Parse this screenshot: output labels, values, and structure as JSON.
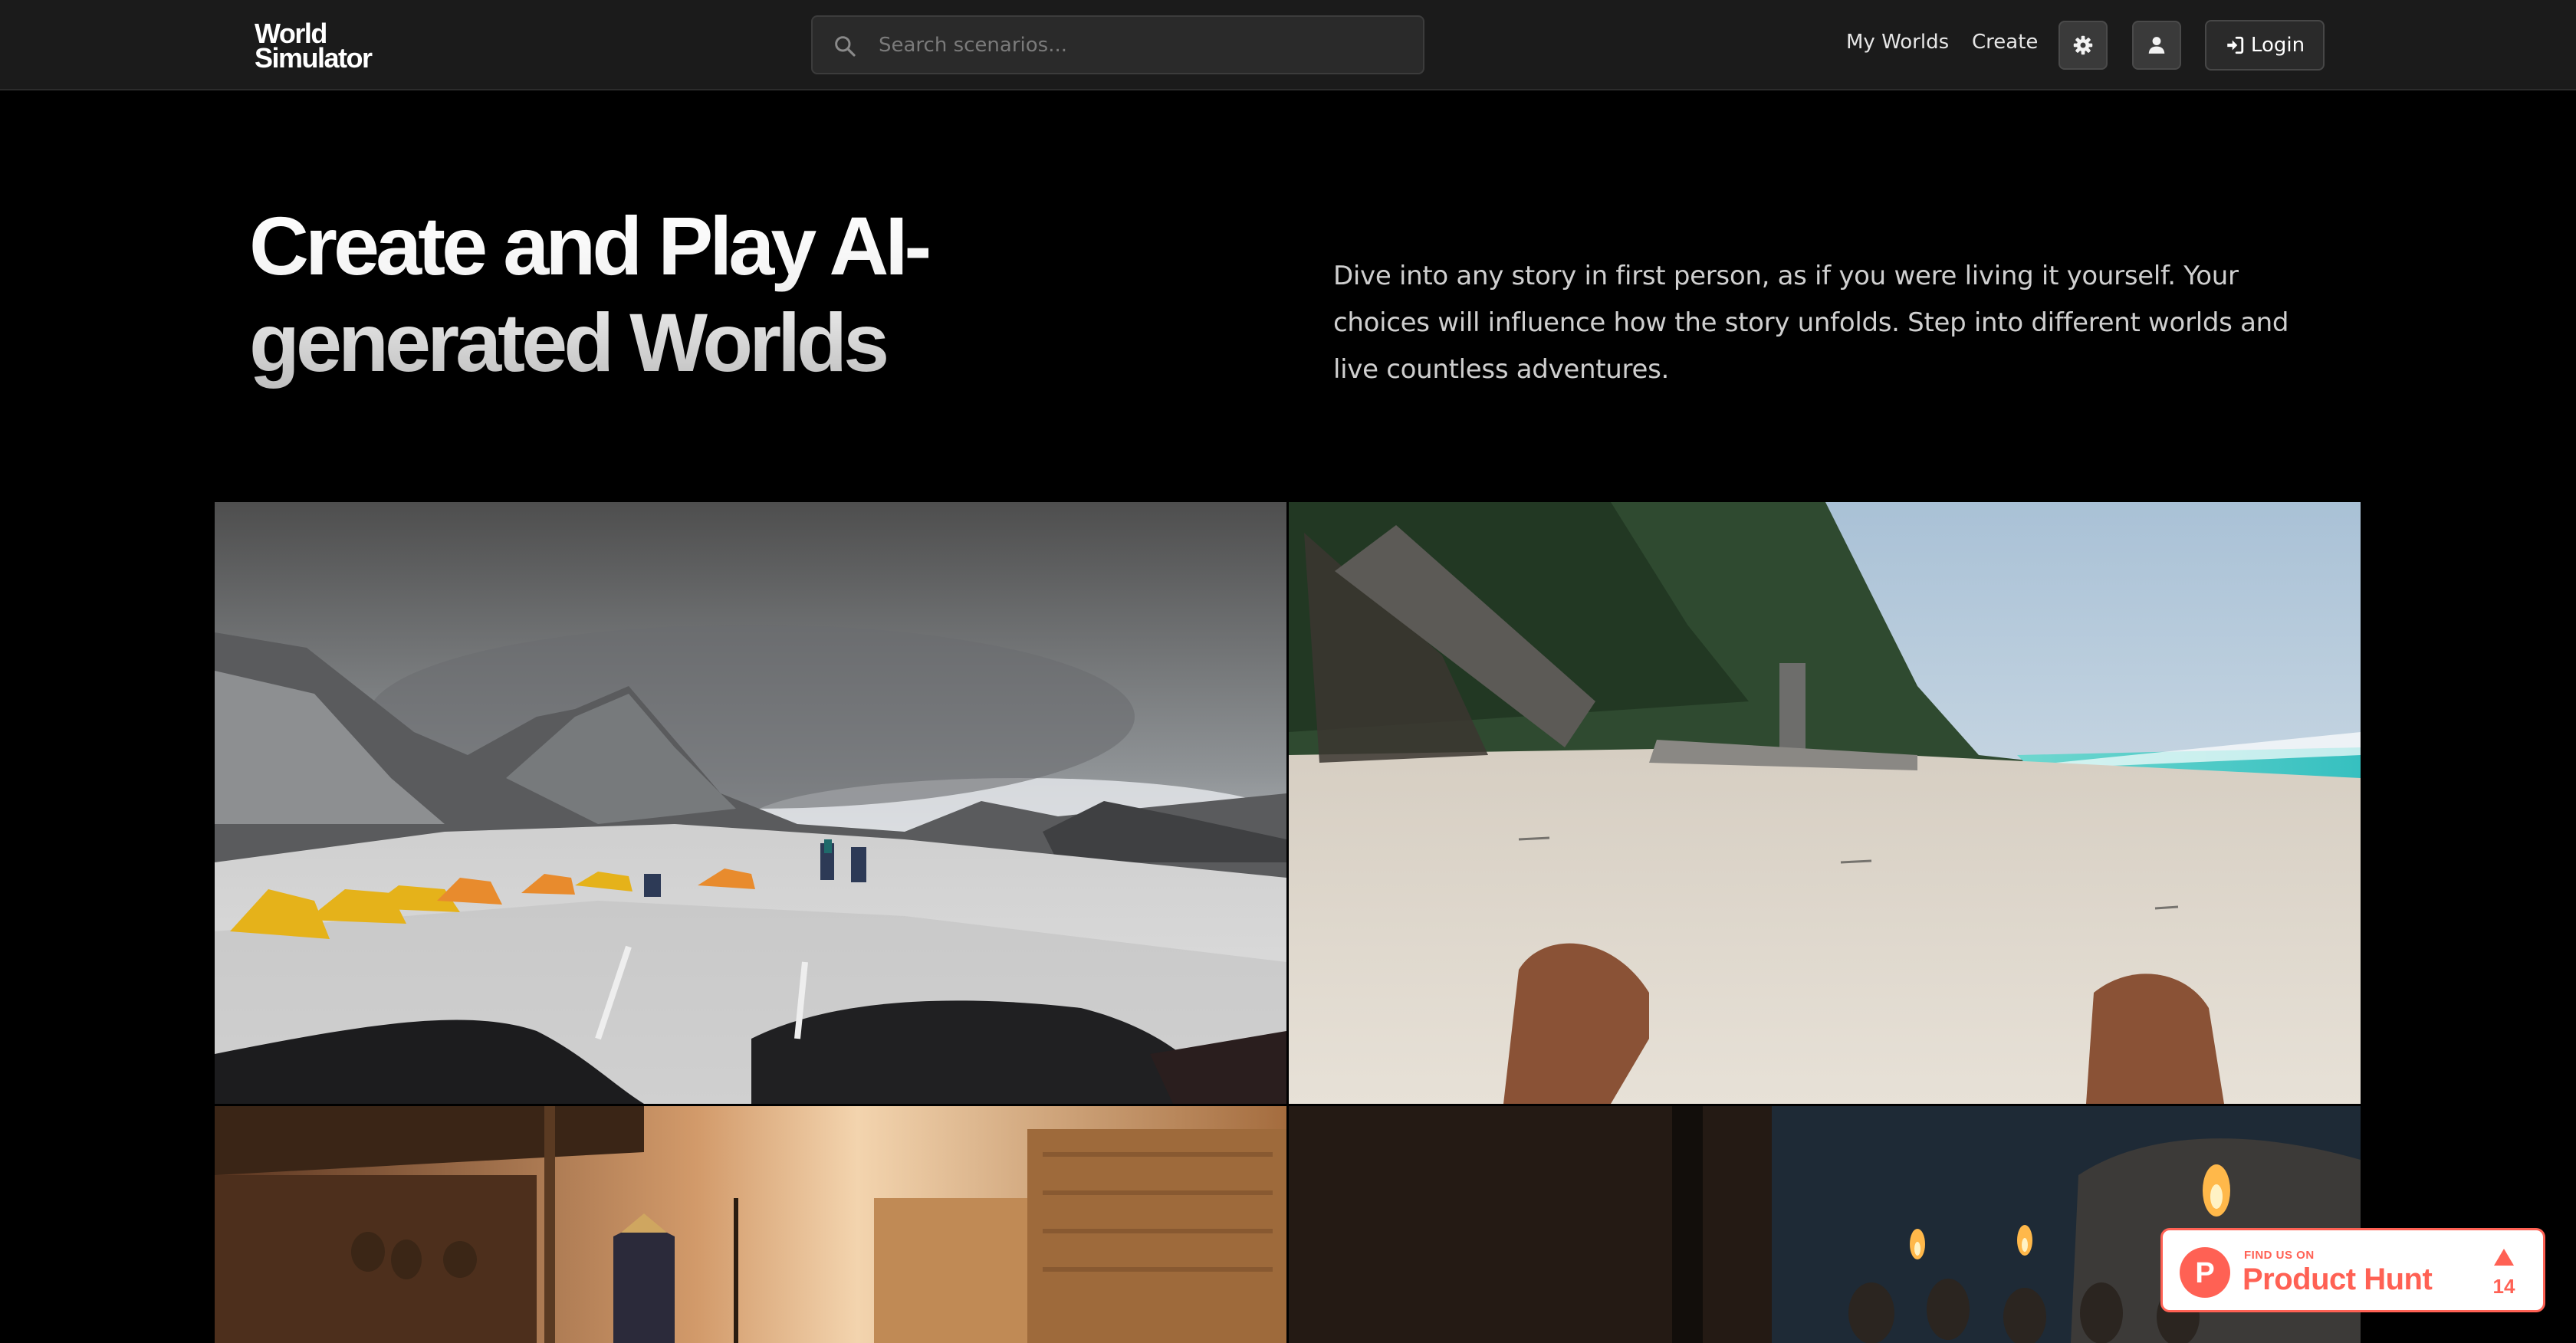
{
  "header": {
    "logo_line1": "World",
    "logo_line2": "Simulator",
    "search_placeholder": "Search scenarios...",
    "nav": {
      "my_worlds": "My Worlds",
      "create": "Create",
      "login": "Login"
    },
    "icons": {
      "search": "search-icon",
      "settings": "gear-icon",
      "profile": "user-icon",
      "login": "sign-in-icon"
    }
  },
  "hero": {
    "title_line1": "Create and Play AI-",
    "title_line2": "generated Worlds",
    "description": "Dive into any story in first person, as if you were living it yourself. Your choices will influence how the story unfolds. Step into different worlds and live countless adventures."
  },
  "scenarios": [
    {
      "scene": "mountain-camp"
    },
    {
      "scene": "beach-plane-crash"
    },
    {
      "scene": "desert-market"
    },
    {
      "scene": "torch-village"
    }
  ],
  "product_hunt": {
    "eyebrow": "FIND US ON",
    "name": "Product Hunt",
    "upvotes": "14",
    "logo_letter": "P",
    "accent": "#ff6154"
  },
  "colors": {
    "background": "#000000",
    "topbar": "#1b1b1b",
    "text_muted": "#cfcfcf"
  }
}
